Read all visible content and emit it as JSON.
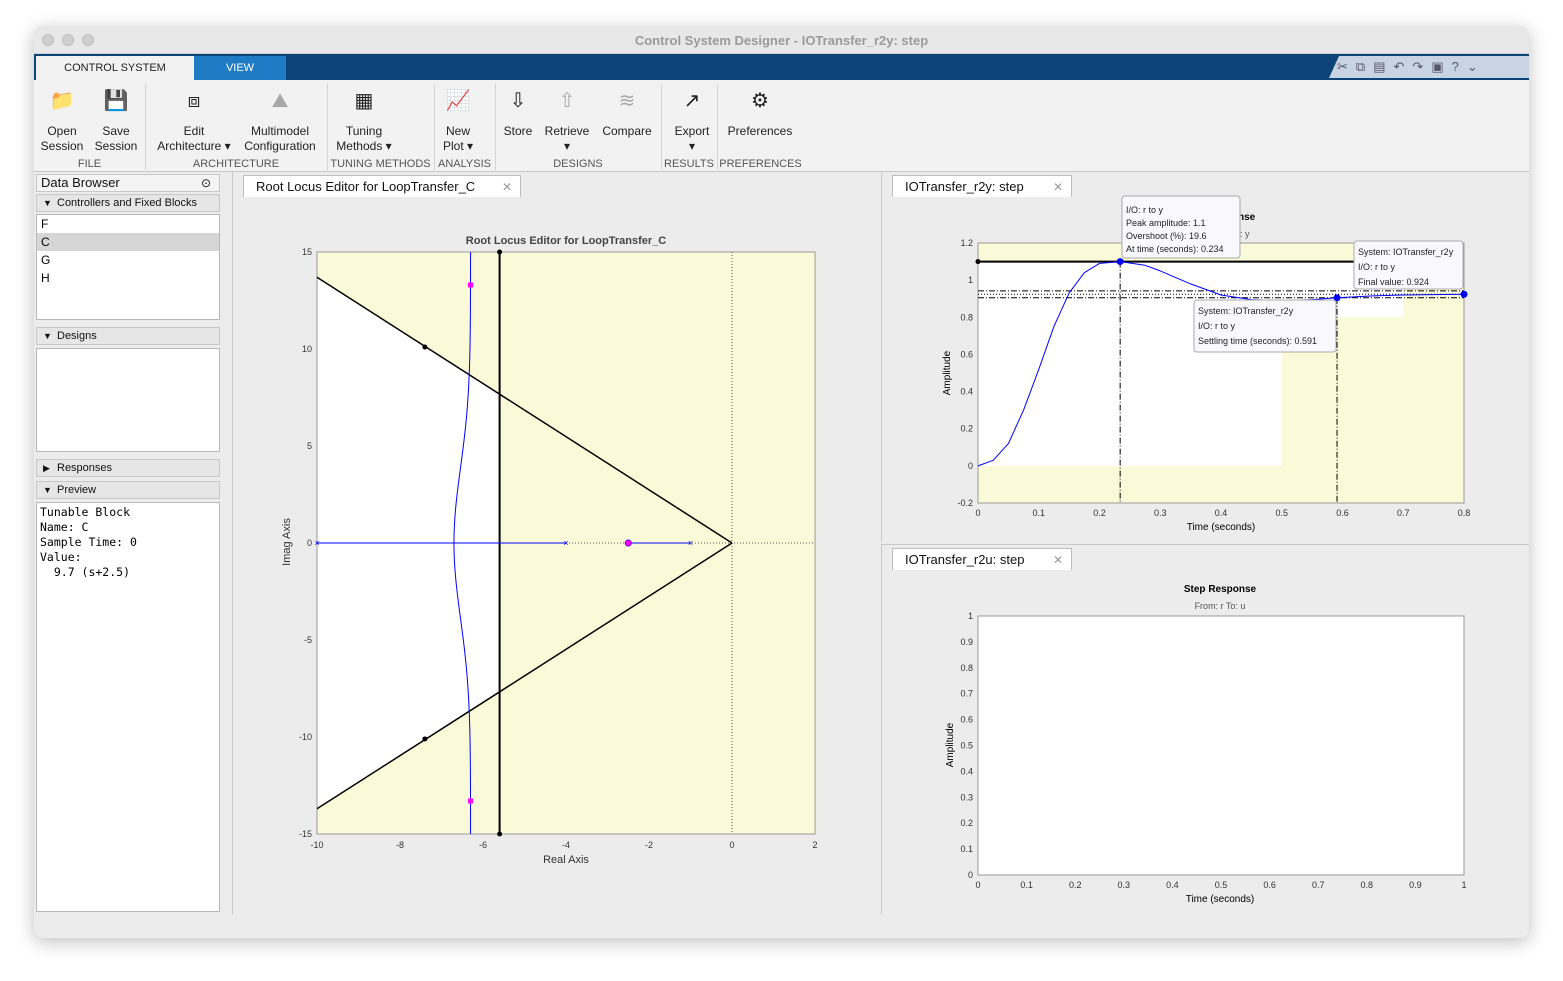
{
  "window": {
    "title": "Control System Designer - IOTransfer_r2y: step"
  },
  "ribbon_tabs": [
    {
      "label": "CONTROL SYSTEM"
    },
    {
      "label": "VIEW"
    }
  ],
  "toolstrip": {
    "buttons": [
      {
        "label1": "Open",
        "label2": "Session",
        "icon": "folder-icon"
      },
      {
        "label1": "Save",
        "label2": "Session",
        "icon": "floppy-icon"
      },
      {
        "label1": "Edit",
        "label2": "Architecture ▾",
        "icon": "block-diagram-icon"
      },
      {
        "label1": "Multimodel",
        "label2": "Configuration",
        "icon": "multimodel-icon"
      },
      {
        "label1": "Tuning",
        "label2": "Methods ▾",
        "icon": "tuning-icon"
      },
      {
        "label1": "New",
        "label2": "Plot ▾",
        "icon": "new-plot-icon"
      },
      {
        "label1": "Store",
        "label2": "",
        "icon": "store-icon"
      },
      {
        "label1": "Retrieve",
        "label2": "▾",
        "icon": "retrieve-icon"
      },
      {
        "label1": "Compare",
        "label2": "",
        "icon": "compare-icon"
      },
      {
        "label1": "Export",
        "label2": "▾",
        "icon": "export-icon"
      },
      {
        "label1": "Preferences",
        "label2": "",
        "icon": "gear-icon"
      }
    ],
    "groups": [
      "FILE",
      "ARCHITECTURE",
      "TUNING METHODS",
      "ANALYSIS",
      "DESIGNS",
      "RESULTS",
      "PREFERENCES"
    ]
  },
  "data_browser": {
    "title": "Data Browser",
    "controllers_header": "Controllers and Fixed Blocks",
    "controllers": [
      "F",
      "C",
      "G",
      "H"
    ],
    "selected": "C",
    "designs_header": "Designs",
    "responses_header": "Responses",
    "preview_header": "Preview",
    "preview_text": "Tunable Block\nName: C\nSample Time: 0\nValue:\n  9.7 (s+2.5)"
  },
  "tabs": {
    "root_locus": "Root Locus Editor for LoopTransfer_C",
    "r2y": "IOTransfer_r2y: step",
    "r2u": "IOTransfer_r2u: step"
  },
  "chart_data": [
    {
      "type": "root-locus",
      "title": "Root Locus Editor for LoopTransfer_C",
      "xlabel": "Real Axis",
      "ylabel": "Imag Axis",
      "xlim": [
        -10,
        2
      ],
      "ylim": [
        -15,
        15
      ],
      "xticks": [
        -10,
        -8,
        -6,
        -4,
        -2,
        0,
        2
      ],
      "yticks": [
        -15,
        -10,
        -5,
        0,
        5,
        10,
        15
      ],
      "poles": [
        [
          -4,
          0
        ],
        [
          -1,
          0
        ],
        [
          -10,
          0
        ]
      ],
      "zeros": [
        [
          -2.5,
          0
        ]
      ],
      "closed_loop_poles": [
        [
          -6.3,
          13.3
        ],
        [
          -6.3,
          -13.3
        ],
        [
          -2.5,
          0
        ]
      ],
      "damping_line_points": [
        [
          -7.4,
          10.1
        ],
        [
          -7.4,
          -10.1
        ]
      ],
      "damping_slope": 1.37,
      "settling_bound_real": -5.6,
      "colors": {
        "locus": "#0000ff",
        "closed_loop_pole": "#ff00ff",
        "region": "#fafad8"
      }
    },
    {
      "type": "line",
      "title": "Step Response",
      "xlabel": "Time (seconds)",
      "ylabel": "Amplitude",
      "xlim": [
        0,
        0.8
      ],
      "ylim": [
        -0.2,
        1.2
      ],
      "xticks": [
        0,
        0.1,
        0.2,
        0.3,
        0.4,
        0.5,
        0.6,
        0.7,
        0.8
      ],
      "yticks": [
        -0.2,
        0,
        0.2,
        0.4,
        0.6,
        0.8,
        1,
        1.2
      ],
      "series": [
        {
          "x": [
            0,
            0.025,
            0.05,
            0.075,
            0.1,
            0.125,
            0.15,
            0.175,
            0.2,
            0.234,
            0.275,
            0.3,
            0.35,
            0.4,
            0.45,
            0.5,
            0.55,
            0.591,
            0.65,
            0.7,
            0.8
          ],
          "y": [
            0,
            0.03,
            0.12,
            0.3,
            0.52,
            0.75,
            0.93,
            1.04,
            1.09,
            1.1,
            1.08,
            1.05,
            0.98,
            0.92,
            0.895,
            0.89,
            0.895,
            0.905,
            0.915,
            0.92,
            0.924
          ]
        }
      ],
      "peak": {
        "t": 0.234,
        "y": 1.1
      },
      "settling": {
        "t": 0.591,
        "y": 0.905
      },
      "final": 0.924,
      "tooltips": [
        {
          "lines": [
            "I/O: r to y",
            "Peak amplitude: 1.1",
            "Overshoot (%): 19.6",
            "At time (seconds): 0.234"
          ]
        },
        {
          "lines": [
            "System: IOTransfer_r2y",
            "I/O: r to y",
            "Final value: 0.924"
          ]
        },
        {
          "lines": [
            "System: IOTransfer_r2y",
            "I/O: r to y",
            "Settling time (seconds): 0.591"
          ]
        }
      ],
      "title_fragment": "nse",
      "subtitle_fragment": ": y"
    },
    {
      "type": "line",
      "title": "Step Response",
      "subtitle": "From: r  To: u",
      "xlabel": "Time (seconds)",
      "ylabel": "Amplitude",
      "xlim": [
        0,
        1
      ],
      "ylim": [
        0,
        1
      ],
      "xticks": [
        0,
        0.1,
        0.2,
        0.3,
        0.4,
        0.5,
        0.6,
        0.7,
        0.8,
        0.9,
        1
      ],
      "yticks": [
        0,
        0.1,
        0.2,
        0.3,
        0.4,
        0.5,
        0.6,
        0.7,
        0.8,
        0.9,
        1
      ],
      "series": []
    }
  ]
}
